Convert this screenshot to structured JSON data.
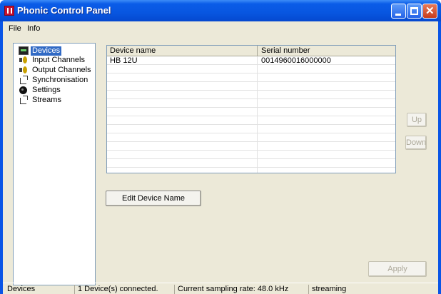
{
  "window": {
    "title": "Phonic Control Panel",
    "accent_color": "#0a55e6",
    "controls": [
      "minimize-icon",
      "maximize-icon",
      "close-icon"
    ]
  },
  "menu": {
    "items": [
      {
        "label": "File"
      },
      {
        "label": "Info"
      }
    ]
  },
  "tree": {
    "items": [
      {
        "label": "Devices",
        "icon": "device-icon",
        "selected": true
      },
      {
        "label": "Input Channels",
        "icon": "speaker-icon"
      },
      {
        "label": "Output Channels",
        "icon": "speaker-icon"
      },
      {
        "label": "Synchronisation",
        "icon": "sync-icon"
      },
      {
        "label": "Settings",
        "icon": "gear-icon"
      },
      {
        "label": "Streams",
        "icon": "stream-icon"
      }
    ]
  },
  "device_table": {
    "headers": {
      "name": "Device name",
      "serial": "Serial number"
    },
    "rows": [
      {
        "name": "HB 12U",
        "serial": "0014960016000000"
      }
    ]
  },
  "buttons": {
    "edit_device_name": "Edit Device Name",
    "up": "Up",
    "down": "Down",
    "apply": "Apply"
  },
  "status": {
    "section": "Devices",
    "connected": "1 Device(s) connected.",
    "sampling_rate": "Current sampling rate: 48.0 kHz",
    "state": "streaming"
  }
}
